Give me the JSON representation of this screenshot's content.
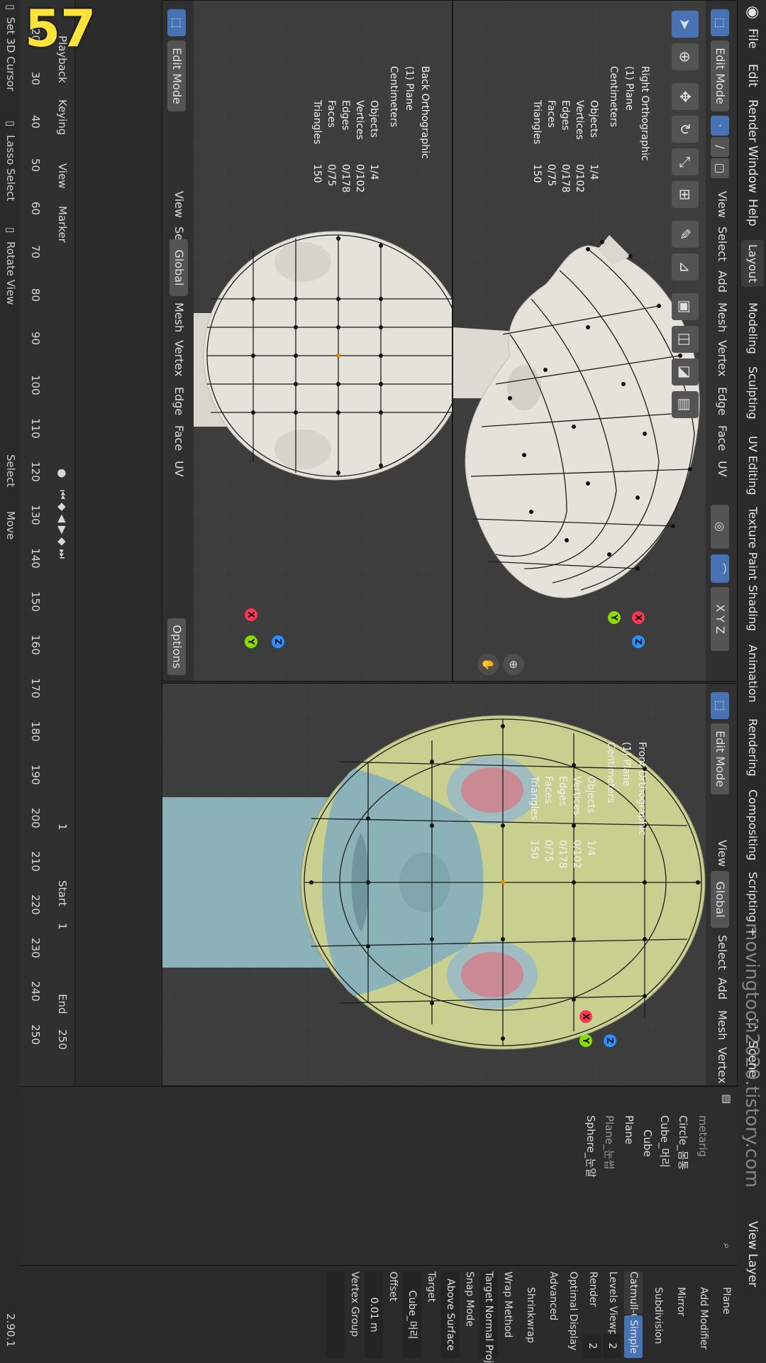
{
  "app": {
    "version": "2.90.1",
    "watermark": "movingtoon2020.tistory.com",
    "badge": "57"
  },
  "menu": [
    "File",
    "Edit",
    "Render",
    "Window",
    "Help"
  ],
  "workspaces": [
    "Layout",
    "Modeling",
    "Sculpting",
    "UV Editing",
    "Texture Paint",
    "Shading",
    "Animation",
    "Rendering",
    "Compositing",
    "Scripting",
    "+"
  ],
  "scene": {
    "name": "Scene",
    "view_layer": "View Layer"
  },
  "viewport_common": {
    "mode": "Edit Mode",
    "menus": [
      "View",
      "Select",
      "Add",
      "Mesh",
      "Vertex",
      "Edge",
      "Face",
      "UV"
    ],
    "transform": "Global",
    "options": "Options",
    "axes": [
      "X",
      "Y",
      "Z"
    ],
    "stats_labels": [
      "Objects",
      "Vertices",
      "Edges",
      "Faces",
      "Triangles"
    ],
    "stats_values": [
      "1/4",
      "0/102",
      "0/178",
      "0/75",
      "150"
    ],
    "stats_values_front": [
      "1/4",
      "0/102",
      "0/178",
      "0/75",
      "150"
    ],
    "collection": "(1) Plane",
    "units": "Centimeters"
  },
  "viewports": {
    "right": {
      "view": "Right Orthographic"
    },
    "back": {
      "view": "Back Orthographic"
    },
    "front": {
      "view": "Front Orthographic"
    }
  },
  "timeline": {
    "playback": "Playback",
    "keying": "Keying",
    "view": "View",
    "marker": "Marker",
    "current_frame": "1",
    "start_label": "Start",
    "start": "1",
    "end_label": "End",
    "end": "250",
    "ticks": [
      "20",
      "30",
      "40",
      "50",
      "60",
      "70",
      "80",
      "90",
      "100",
      "110",
      "120",
      "130",
      "140",
      "150",
      "160",
      "170",
      "180",
      "190",
      "200",
      "210",
      "220",
      "230",
      "240",
      "250"
    ]
  },
  "statusbar": {
    "left": "Set 3D Cursor",
    "mid1": "Lasso Select",
    "mid2": "Rotate View",
    "right1": "Select",
    "right2": "Move",
    "version": "2.90.1"
  },
  "outliner": {
    "items": [
      "metarig",
      "Circle_몸통",
      "Cube_머리",
      "Cube",
      "Plane",
      "Plane_눈썹",
      "Sphere_눈알"
    ]
  },
  "properties": {
    "object": "Plane",
    "add_modifier": "Add Modifier",
    "modifiers": [
      "Mirror",
      "Subdivision",
      "Shrinkwrap"
    ],
    "subdivision": {
      "catmull": "Catmull-Clark",
      "simple": "Simple",
      "levels_label": "Levels Viewpo",
      "levels": "2",
      "render_label": "Render",
      "render": "2",
      "optimal": "Optimal Display",
      "advanced": "Advanced"
    },
    "shrinkwrap": {
      "wrap_label": "Wrap Method",
      "wrap": "Target Normal Project",
      "snap_label": "Snap Mode",
      "snap": "Above Surface",
      "target_label": "Target",
      "target": "Cube_머리",
      "offset_label": "Offset",
      "offset": "0.01 m",
      "vgroup_label": "Vertex Group"
    }
  },
  "colors": {
    "x": "#ff3352",
    "y": "#8bdc00",
    "z": "#2890ff",
    "accent": "#4772b3",
    "face": "#c8cf8f",
    "skin": "#8ab2b8"
  }
}
